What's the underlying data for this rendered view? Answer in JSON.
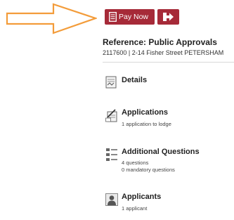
{
  "toolbar": {
    "pay_label": "Pay Now",
    "pay_icon": "document-icon",
    "exit_icon": "exit-arrow-icon",
    "button_color": "#a62a38"
  },
  "reference": {
    "title": "Reference: Public Approvals",
    "subtitle": "2117600 | 2-14 Fisher Street PETERSHAM"
  },
  "sections": {
    "details": {
      "title": "Details",
      "icon": "scroll-icon"
    },
    "applications": {
      "title": "Applications",
      "line1": "1 application to lodge",
      "icon": "pen-document-icon"
    },
    "additional_questions": {
      "title": "Additional Questions",
      "line1": "4 questions",
      "line2": "0 mandatory questions",
      "icon": "list-icon"
    },
    "applicants": {
      "title": "Applicants",
      "line1": "1 applicant",
      "icon": "person-icon"
    }
  },
  "annotation": {
    "arrow_color": "#f39c3a"
  }
}
